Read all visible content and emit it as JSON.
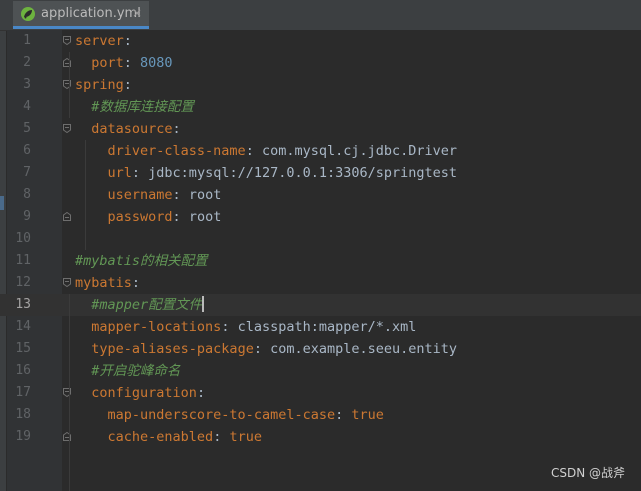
{
  "tab": {
    "label": "application.yml",
    "close": "×",
    "icon": "spring-leaf-icon"
  },
  "colors": {
    "key": "#cc7832",
    "value": "#a9b7c6",
    "number": "#6897bb",
    "comment": "#629755",
    "background": "#2b2b2b"
  },
  "lines": [
    {
      "no": "1",
      "indent": "",
      "key": "server",
      "sep": ":",
      "value": "",
      "vtype": "",
      "comment": ""
    },
    {
      "no": "2",
      "indent": "  ",
      "key": "port",
      "sep": ": ",
      "value": "8080",
      "vtype": "n",
      "comment": ""
    },
    {
      "no": "3",
      "indent": "",
      "key": "spring",
      "sep": ":",
      "value": "",
      "vtype": "",
      "comment": ""
    },
    {
      "no": "4",
      "indent": "  ",
      "key": "",
      "sep": "",
      "value": "",
      "vtype": "",
      "comment": "#数据库连接配置"
    },
    {
      "no": "5",
      "indent": "  ",
      "key": "datasource",
      "sep": ":",
      "value": "",
      "vtype": "",
      "comment": ""
    },
    {
      "no": "6",
      "indent": "    ",
      "key": "driver-class-name",
      "sep": ": ",
      "value": "com.mysql.cj.jdbc.Driver",
      "vtype": "v",
      "comment": ""
    },
    {
      "no": "7",
      "indent": "    ",
      "key": "url",
      "sep": ": ",
      "value": "jdbc:mysql://127.0.0.1:3306/springtest",
      "vtype": "v",
      "comment": ""
    },
    {
      "no": "8",
      "indent": "    ",
      "key": "username",
      "sep": ": ",
      "value": "root",
      "vtype": "v",
      "comment": ""
    },
    {
      "no": "9",
      "indent": "    ",
      "key": "password",
      "sep": ": ",
      "value": "root",
      "vtype": "v",
      "comment": ""
    },
    {
      "no": "10",
      "indent": "",
      "key": "",
      "sep": "",
      "value": "",
      "vtype": "",
      "comment": ""
    },
    {
      "no": "11",
      "indent": "",
      "key": "",
      "sep": "",
      "value": "",
      "vtype": "",
      "comment": "#mybatis的相关配置"
    },
    {
      "no": "12",
      "indent": "",
      "key": "mybatis",
      "sep": ":",
      "value": "",
      "vtype": "",
      "comment": ""
    },
    {
      "no": "13",
      "indent": "  ",
      "key": "",
      "sep": "",
      "value": "",
      "vtype": "",
      "comment": "#mapper配置文件"
    },
    {
      "no": "14",
      "indent": "  ",
      "key": "mapper-locations",
      "sep": ": ",
      "value": "classpath:mapper/*.xml",
      "vtype": "v",
      "comment": ""
    },
    {
      "no": "15",
      "indent": "  ",
      "key": "type-aliases-package",
      "sep": ": ",
      "value": "com.example.seeu.entity",
      "vtype": "v",
      "comment": ""
    },
    {
      "no": "16",
      "indent": "  ",
      "key": "",
      "sep": "",
      "value": "",
      "vtype": "",
      "comment": "#开启驼峰命名"
    },
    {
      "no": "17",
      "indent": "  ",
      "key": "configuration",
      "sep": ":",
      "value": "",
      "vtype": "",
      "comment": ""
    },
    {
      "no": "18",
      "indent": "    ",
      "key": "map-underscore-to-camel-case",
      "sep": ": ",
      "value": "true",
      "vtype": "k",
      "comment": ""
    },
    {
      "no": "19",
      "indent": "    ",
      "key": "cache-enabled",
      "sep": ": ",
      "value": "true",
      "vtype": "k",
      "comment": ""
    }
  ],
  "current_line": "13",
  "fold_markers": {
    "open": [
      "1",
      "3",
      "5",
      "12",
      "17"
    ],
    "close": [
      "2",
      "9",
      "19"
    ]
  },
  "watermark": "CSDN @战斧"
}
